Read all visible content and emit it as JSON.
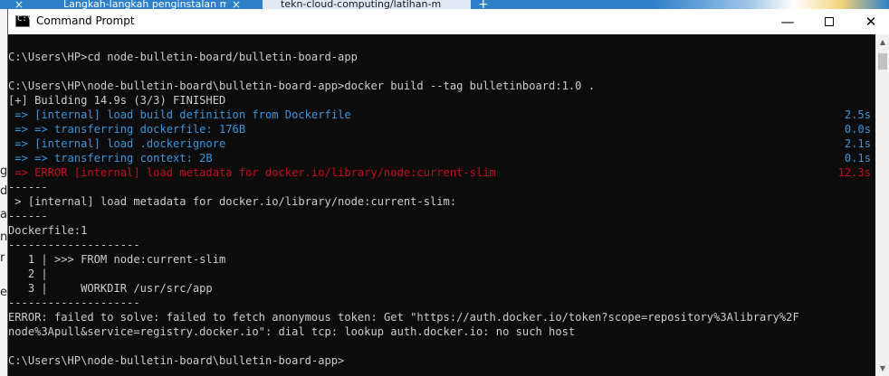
{
  "browser": {
    "tab1_label": "Langkah-langkah penginstalan m",
    "tab2_label": "tekn-cloud-computing/latihan-m",
    "close_glyph": "×",
    "new_tab_glyph": "+"
  },
  "background_letters": [
    "g",
    "d",
    "a",
    "n",
    "r",
    "e"
  ],
  "window": {
    "title": "Command Prompt",
    "icon_text": "C:\\",
    "minimize_glyph": "—",
    "close_glyph": "✕"
  },
  "console": {
    "lines": [
      {
        "text": "",
        "color": "default"
      },
      {
        "text": "C:\\Users\\HP>cd node-bulletin-board/bulletin-board-app",
        "color": "default"
      },
      {
        "text": "",
        "color": "default"
      },
      {
        "text": "C:\\Users\\HP\\node-bulletin-board\\bulletin-board-app>docker build --tag bulletinboard:1.0 .",
        "color": "default"
      },
      {
        "text": "[+] Building 14.9s (3/3) FINISHED",
        "color": "default"
      },
      {
        "text": " => [internal] load build definition from Dockerfile",
        "color": "blue",
        "duration": "2.5s"
      },
      {
        "text": " => => transferring dockerfile: 176B",
        "color": "blue",
        "duration": "0.0s"
      },
      {
        "text": " => [internal] load .dockerignore",
        "color": "blue",
        "duration": "2.1s"
      },
      {
        "text": " => => transferring context: 2B",
        "color": "blue",
        "duration": "0.1s"
      },
      {
        "text": " => ERROR [internal] load metadata for docker.io/library/node:current-slim",
        "color": "red",
        "duration": "12.3s"
      },
      {
        "text": "------",
        "color": "default"
      },
      {
        "text": " > [internal] load metadata for docker.io/library/node:current-slim:",
        "color": "default"
      },
      {
        "text": "------",
        "color": "default"
      },
      {
        "text": "Dockerfile:1",
        "color": "default"
      },
      {
        "text": "--------------------",
        "color": "default"
      },
      {
        "text": "   1 | >>> FROM node:current-slim",
        "color": "default"
      },
      {
        "text": "   2 |",
        "color": "default"
      },
      {
        "text": "   3 |     WORKDIR /usr/src/app",
        "color": "default"
      },
      {
        "text": "--------------------",
        "color": "default"
      },
      {
        "text": "ERROR: failed to solve: failed to fetch anonymous token: Get \"https://auth.docker.io/token?scope=repository%3Alibrary%2F",
        "color": "default"
      },
      {
        "text": "node%3Apull&service=registry.docker.io\": dial tcp: lookup auth.docker.io: no such host",
        "color": "default"
      },
      {
        "text": "",
        "color": "default"
      },
      {
        "text": "C:\\Users\\HP\\node-bulletin-board\\bulletin-board-app>",
        "color": "default"
      }
    ]
  },
  "scrollbar": {
    "up_glyph": "▲",
    "down_glyph": "▼"
  }
}
